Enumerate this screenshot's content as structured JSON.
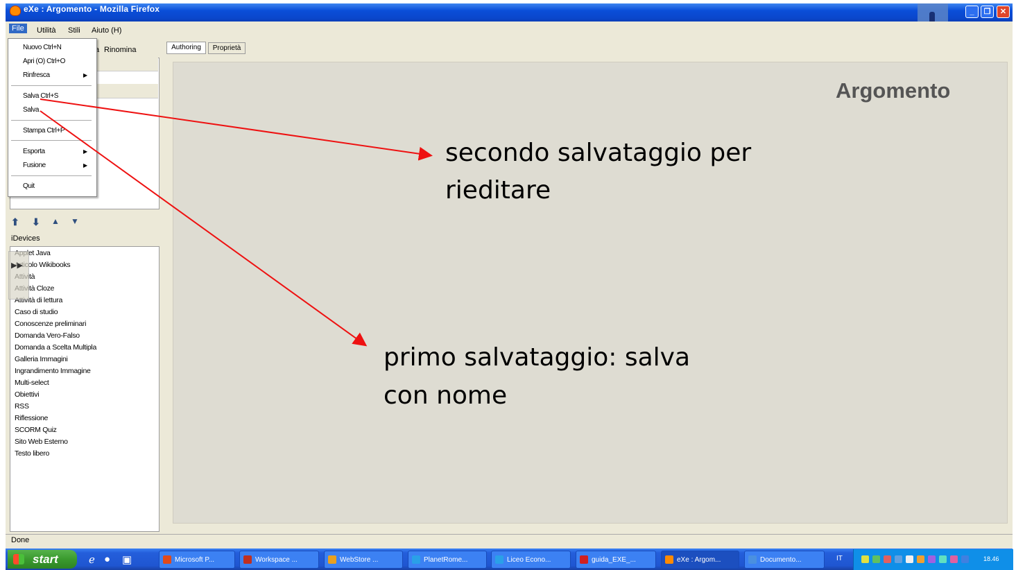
{
  "window": {
    "title": "eXe : Argomento - Mozilla Firefox"
  },
  "menubar": {
    "file": "File",
    "utilita": "Utilità",
    "stili": "Stili",
    "aiuto": "Aiuto (H)"
  },
  "outline_toolbar": {
    "partial": "a",
    "rinomina": "Rinomina"
  },
  "file_menu": {
    "items": [
      {
        "label": "Nuovo   Ctrl+N"
      },
      {
        "label": "Apri (O) Ctrl+O"
      },
      {
        "label": "Rinfresca"
      },
      {
        "label": "Salva   Ctrl+S"
      },
      {
        "label": "Salva"
      },
      {
        "label": "Stampa  Ctrl+P"
      },
      {
        "label": "Esporta"
      },
      {
        "label": "Fusione"
      },
      {
        "label": "Quit"
      }
    ]
  },
  "devices": {
    "label": "iDevices",
    "items": [
      "Applet Java",
      "Articolo Wikibooks",
      "Attività",
      "Attività Cloze",
      "Attività di lettura",
      "Caso di studio",
      "Conoscenze preliminari",
      "Domanda Vero-Falso",
      "Domanda a Scelta Multipla",
      "Galleria Immagini",
      "Ingrandimento Immagine",
      "Multi-select",
      "Obiettivi",
      "RSS",
      "Riflessione",
      "SCORM Quiz",
      "Sito Web Esterno",
      "Testo libero"
    ]
  },
  "tabs": {
    "authoring": "Authoring",
    "proprieta": "Proprietà"
  },
  "content": {
    "title": "Argomento"
  },
  "annotations": {
    "note1_line1": "secondo salvataggio per",
    "note1_line2": "rieditare",
    "note2_line1": "primo salvataggio: salva",
    "note2_line2": "con nome",
    "arrow_color": "#ee1111"
  },
  "status": {
    "text": "Done"
  },
  "taskbar": {
    "start": "start",
    "tasks": [
      {
        "label": "Microsoft P...",
        "color": "#e04a1a"
      },
      {
        "label": "Workspace ...",
        "color": "#c03020"
      },
      {
        "label": "WebStore ...",
        "color": "#e8a020"
      },
      {
        "label": "PlanetRome...",
        "color": "#2aa0e8"
      },
      {
        "label": "Liceo Econo...",
        "color": "#2aa0e8"
      },
      {
        "label": "guida_EXE_...",
        "color": "#d02020"
      },
      {
        "label": "eXe : Argom...",
        "color": "#ff8a00"
      },
      {
        "label": "Documento...",
        "color": "#4a90e0"
      }
    ],
    "language": "IT",
    "clock": "18.46"
  }
}
